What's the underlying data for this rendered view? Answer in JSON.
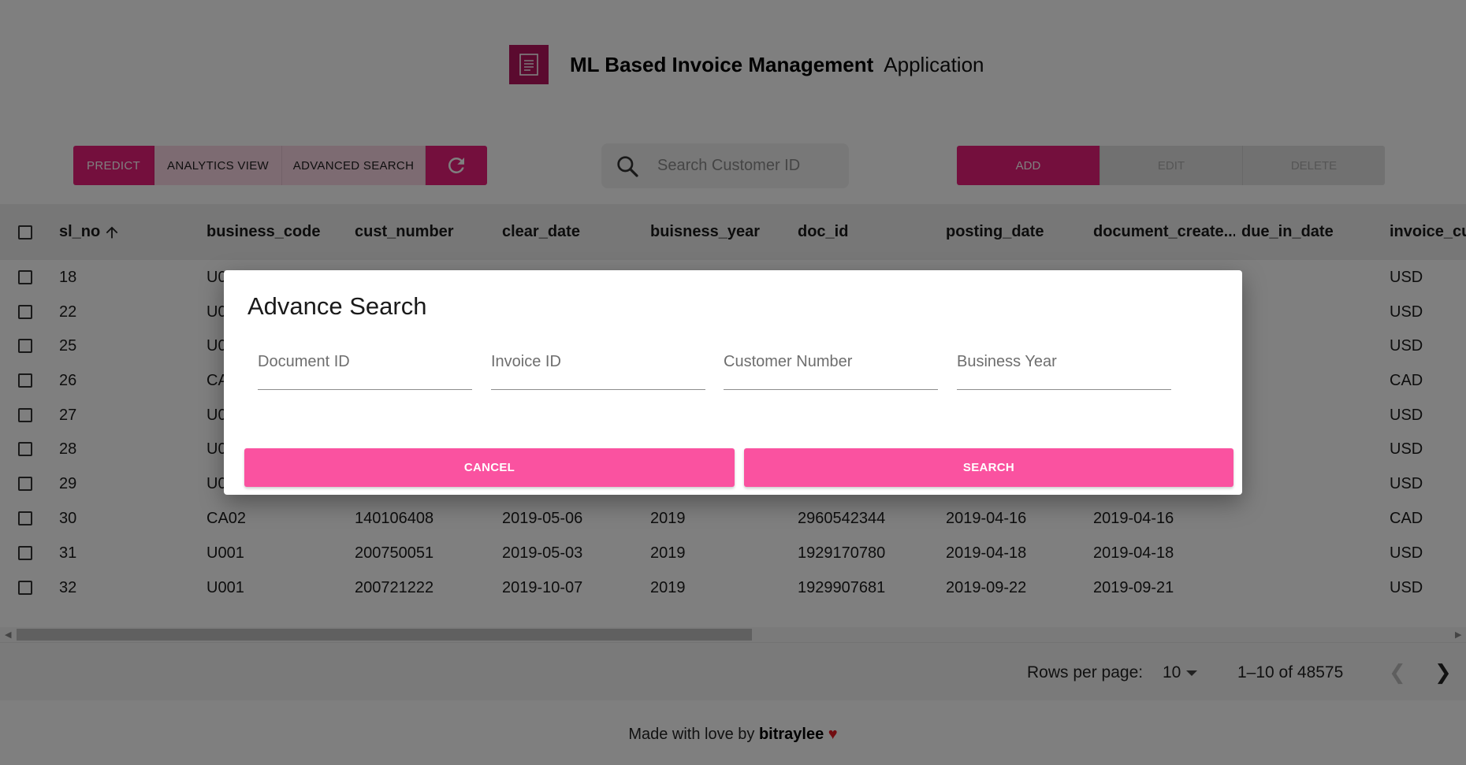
{
  "header": {
    "title": "ML Based Invoice Management",
    "subtitle": "Application",
    "logo_icon": "invoice-document-icon"
  },
  "toolbar": {
    "predict_label": "PREDICT",
    "analytics_label": "ANALYTICS VIEW",
    "advanced_search_label": "ADVANCED SEARCH",
    "refresh_icon": "refresh-icon",
    "search_placeholder": "Search Customer ID",
    "add_label": "ADD",
    "edit_label": "EDIT",
    "delete_label": "DELETE"
  },
  "table": {
    "columns": [
      "sl_no",
      "business_code",
      "cust_number",
      "clear_date",
      "buisness_year",
      "doc_id",
      "posting_date",
      "document_create...",
      "due_in_date",
      "invoice_cu"
    ],
    "rows": [
      {
        "sl_no": "18",
        "business_code": "U0",
        "cust_number": "",
        "clear_date": "",
        "buisness_year": "",
        "doc_id": "",
        "posting_date": "",
        "document_create": "",
        "due_in_date": "",
        "invoice_currency": "USD"
      },
      {
        "sl_no": "22",
        "business_code": "U0",
        "cust_number": "",
        "clear_date": "",
        "buisness_year": "",
        "doc_id": "",
        "posting_date": "",
        "document_create": "",
        "due_in_date": "",
        "invoice_currency": "USD"
      },
      {
        "sl_no": "25",
        "business_code": "U0",
        "cust_number": "",
        "clear_date": "",
        "buisness_year": "",
        "doc_id": "",
        "posting_date": "",
        "document_create": "",
        "due_in_date": "",
        "invoice_currency": "USD"
      },
      {
        "sl_no": "26",
        "business_code": "CA",
        "cust_number": "",
        "clear_date": "",
        "buisness_year": "",
        "doc_id": "",
        "posting_date": "",
        "document_create": "",
        "due_in_date": "",
        "invoice_currency": "CAD"
      },
      {
        "sl_no": "27",
        "business_code": "U0",
        "cust_number": "",
        "clear_date": "",
        "buisness_year": "",
        "doc_id": "",
        "posting_date": "",
        "document_create": "",
        "due_in_date": "",
        "invoice_currency": "USD"
      },
      {
        "sl_no": "28",
        "business_code": "U0",
        "cust_number": "",
        "clear_date": "",
        "buisness_year": "",
        "doc_id": "",
        "posting_date": "",
        "document_create": "",
        "due_in_date": "",
        "invoice_currency": "USD"
      },
      {
        "sl_no": "29",
        "business_code": "U0",
        "cust_number": "",
        "clear_date": "",
        "buisness_year": "",
        "doc_id": "",
        "posting_date": "",
        "document_create": "",
        "due_in_date": "",
        "invoice_currency": "USD"
      },
      {
        "sl_no": "30",
        "business_code": "CA02",
        "cust_number": "140106408",
        "clear_date": "2019-05-06",
        "buisness_year": "2019",
        "doc_id": "2960542344",
        "posting_date": "2019-04-16",
        "document_create": "2019-04-16",
        "due_in_date": "",
        "invoice_currency": "CAD"
      },
      {
        "sl_no": "31",
        "business_code": "U001",
        "cust_number": "200750051",
        "clear_date": "2019-05-03",
        "buisness_year": "2019",
        "doc_id": "1929170780",
        "posting_date": "2019-04-18",
        "document_create": "2019-04-18",
        "due_in_date": "",
        "invoice_currency": "USD"
      },
      {
        "sl_no": "32",
        "business_code": "U001",
        "cust_number": "200721222",
        "clear_date": "2019-10-07",
        "buisness_year": "2019",
        "doc_id": "1929907681",
        "posting_date": "2019-09-22",
        "document_create": "2019-09-21",
        "due_in_date": "",
        "invoice_currency": "USD"
      }
    ]
  },
  "pagination": {
    "rows_per_page_label": "Rows per page:",
    "rows_per_page_value": "10",
    "range_text": "1–10 of 48575"
  },
  "footer": {
    "prefix": "Made with love by",
    "author": "bitraylee",
    "heart": "♥"
  },
  "dialog": {
    "title": "Advance Search",
    "fields": [
      {
        "placeholder": "Document ID",
        "value": ""
      },
      {
        "placeholder": "Invoice ID",
        "value": ""
      },
      {
        "placeholder": "Customer Number",
        "value": ""
      },
      {
        "placeholder": "Business Year",
        "value": ""
      }
    ],
    "cancel_label": "CANCEL",
    "search_label": "SEARCH"
  },
  "colors": {
    "primary": "#e91e7a",
    "primary_light": "#fbd6e4",
    "dialog_button": "#fa52a0",
    "overlay": "#000000"
  }
}
